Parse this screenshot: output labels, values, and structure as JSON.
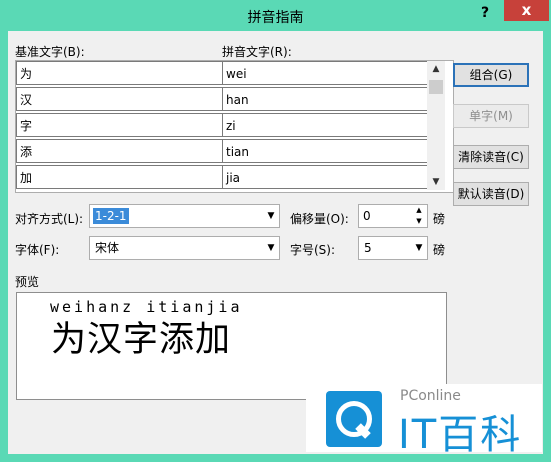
{
  "window": {
    "title": "拼音指南",
    "help": "?",
    "close": "x"
  },
  "labels": {
    "base_text": "基准文字(B):",
    "pinyin_text": "拼音文字(R):",
    "align": "对齐方式(L):",
    "offset": "偏移量(O):",
    "font": "字体(F):",
    "size": "字号(S):",
    "preview": "预览",
    "offset_unit": "磅",
    "size_unit": "磅"
  },
  "rows": [
    {
      "base": "为",
      "pinyin": "wei"
    },
    {
      "base": "汉",
      "pinyin": "han"
    },
    {
      "base": "字",
      "pinyin": "zi"
    },
    {
      "base": "添",
      "pinyin": "tian"
    },
    {
      "base": "加",
      "pinyin": "jia"
    }
  ],
  "buttons": {
    "group": "组合(G)",
    "single": "单字(M)",
    "clear": "清除读音(C)",
    "default_reading": "默认读音(D)"
  },
  "fields": {
    "align": "1-2-1",
    "offset": "0",
    "font": "宋体",
    "size": "5"
  },
  "preview": {
    "ruby": "weihanz itianjia",
    "base": "为汉字添加"
  },
  "watermark": {
    "small": "PConline",
    "big": "IT百科"
  },
  "icons": {
    "scroll_up": "triangle-up",
    "scroll_down": "triangle-down",
    "dropdown": "chevron-down"
  }
}
